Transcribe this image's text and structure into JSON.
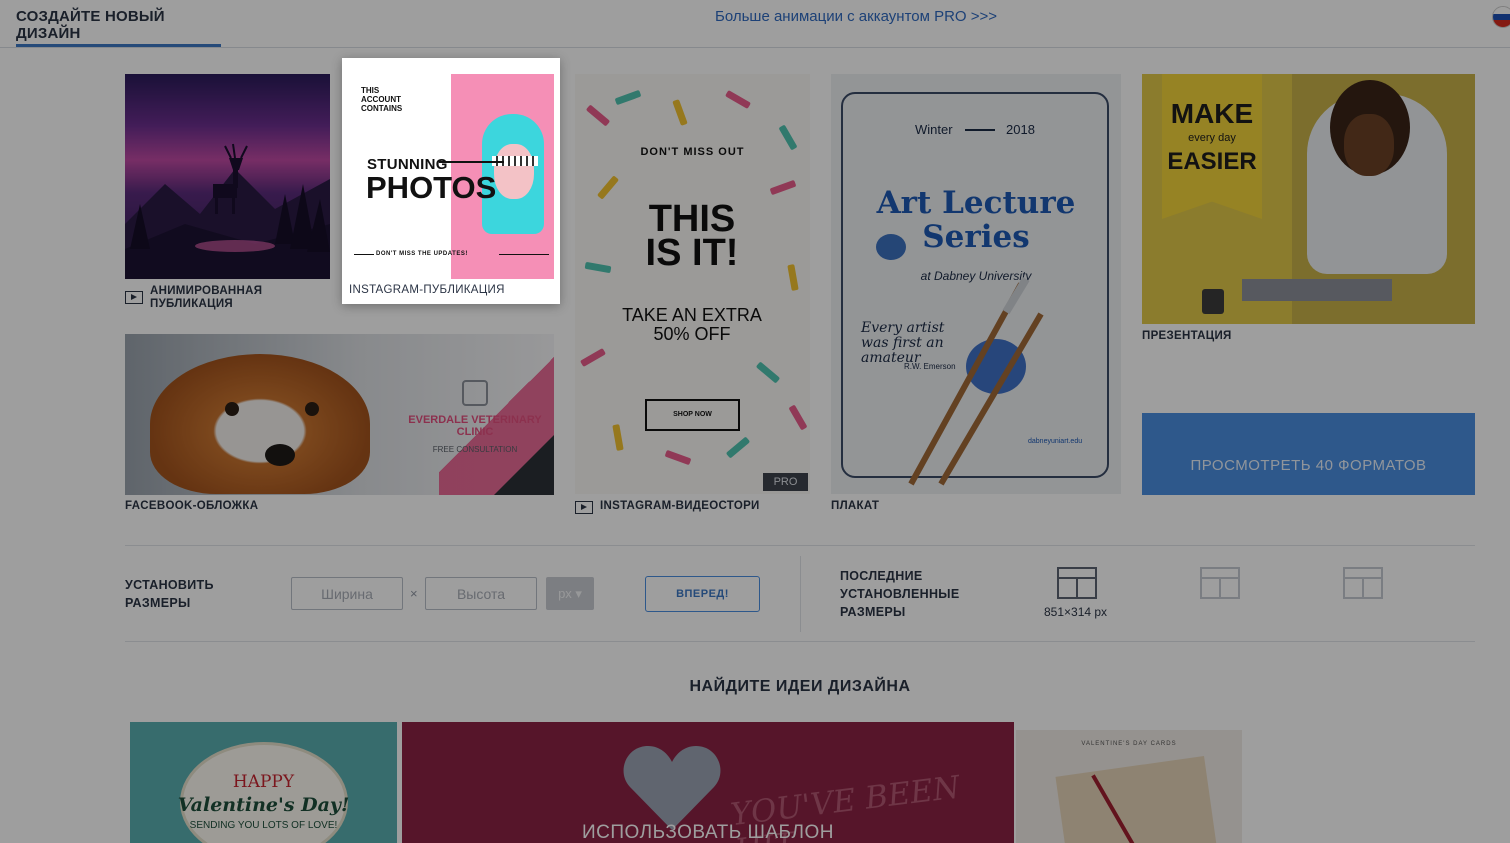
{
  "header": {
    "tab_create": "СОЗДАЙТЕ НОВЫЙ ДИЗАЙН",
    "promo_link": "Больше анимации с аккаунтом PRO >>>",
    "language_flag": "flag-ru-icon"
  },
  "templates": {
    "animated_post": {
      "label": "АНИМИРОВАННАЯ ПУБЛИКАЦИЯ",
      "icon": "play-icon"
    },
    "instagram_post": {
      "label": "INSTAGRAM-ПУБЛИКАЦИЯ",
      "art": {
        "small": "THIS ACCOUNT CONTAINS",
        "stunning": "STUNNING",
        "photos": "PHOTOS",
        "bottom": "DON'T MISS THE UPDATES!"
      }
    },
    "instagram_story": {
      "label": "INSTAGRAM-ВИДЕОСТОРИ",
      "icon": "play-icon",
      "badge": "PRO",
      "art": {
        "top": "DON'T MISS OUT",
        "headline": "THIS IS IT!",
        "offer": "TAKE AN EXTRA 50% OFF",
        "button": "SHOP NOW"
      }
    },
    "poster": {
      "label": "ПЛАКАТ",
      "art": {
        "season": "Winter",
        "year": "2018",
        "title": "Art Lecture Series",
        "venue": "at Dabney University",
        "quote": "Every artist was first an amateur",
        "author": "R.W. Emerson",
        "site": "dabneyuniart.edu"
      }
    },
    "presentation": {
      "label": "ПРЕЗЕНТАЦИЯ",
      "art": {
        "make": "MAKE",
        "every_day": "every day",
        "easier": "EASIER"
      }
    },
    "facebook_cover": {
      "label": "FACEBOOK-ОБЛОЖКА",
      "art": {
        "clinic": "EVERDALE VETERINARY CLINIC",
        "free": "FREE CONSULTATION"
      }
    },
    "view_formats_button": "ПРОСМОТРЕТЬ 40 ФОРМАТОВ"
  },
  "custom_size": {
    "label": "УСТАНОВИТЬ РАЗМЕРЫ",
    "width_placeholder": "Ширина",
    "height_placeholder": "Высота",
    "times": "×",
    "unit": "px ▾",
    "go_button": "ВПЕРЕД!"
  },
  "recent_sizes": {
    "label": "ПОСЛЕДНИЕ УСТАНОВЛЕННЫЕ РАЗМЕРЫ",
    "items": [
      {
        "size": "851×314 px",
        "icon": "layout-icon"
      },
      {
        "size": "",
        "icon": "layout-icon"
      },
      {
        "size": "",
        "icon": "layout-icon"
      }
    ]
  },
  "ideas": {
    "title": "НАЙДИТЕ ИДЕИ ДИЗАЙНА",
    "card1": {
      "happy": "HAPPY",
      "valentine": "Valentine's Day!",
      "sending": "SENDING YOU LOTS OF LOVE!"
    },
    "card2": {
      "hit": "YOU'VE BEEN HIT",
      "use_template": "ИСПОЛЬЗОВАТЬ ШАБЛОН"
    },
    "card3": {
      "title": "VALENTINE'S DAY CARDS"
    }
  },
  "colors": {
    "accent": "#3d78c4",
    "button_blue": "#4b8fe0",
    "overlay": "rgba(0,0,0,0.38)"
  }
}
